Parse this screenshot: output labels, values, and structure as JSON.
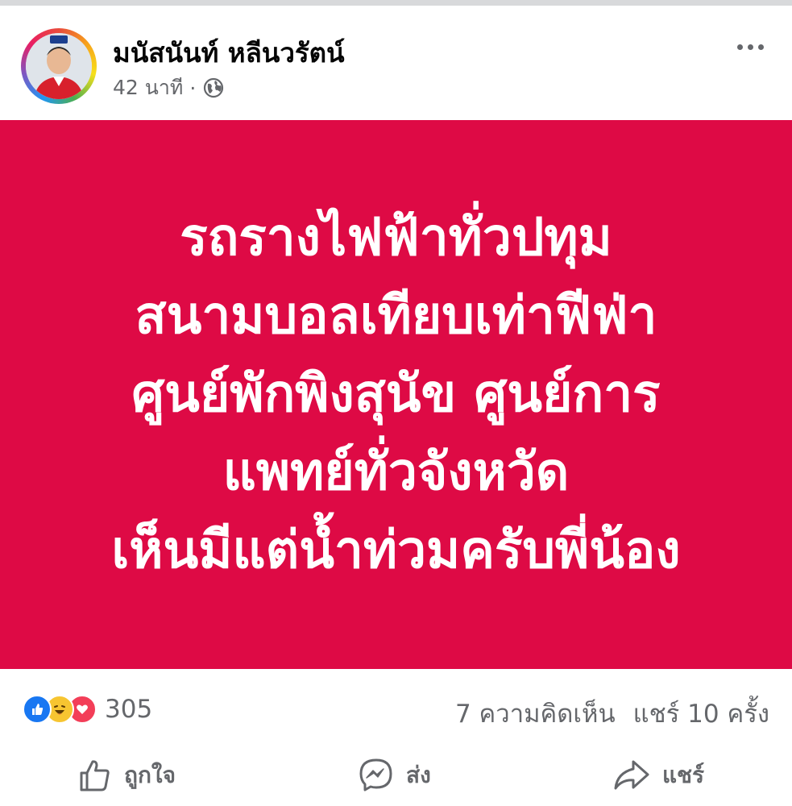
{
  "post": {
    "author": "มนัสนันท์ หลีนวรัตน์",
    "time": "42 นาที",
    "separator": "·",
    "privacy_icon": "globe-icon",
    "banner": {
      "background": "#de0a45",
      "lines": [
        "รถรางไฟฟ้าทั่วปทุม",
        "สนามบอลเทียบเท่าฟีฟ่า",
        "ศูนย์พักพิงสุนัข ศูนย์การ",
        "แพทย์ทั่วจังหวัด",
        "เห็นมีแต่น้ำท่วมครับพี่น้อง"
      ]
    }
  },
  "stats": {
    "reaction_icons": [
      "like-icon",
      "haha-icon",
      "love-icon"
    ],
    "reaction_count": "305",
    "comments": "7 ความคิดเห็น",
    "shares": "แชร์ 10 ครั้ง"
  },
  "actions": {
    "like": "ถูกใจ",
    "send": "ส่ง",
    "share": "แชร์"
  },
  "colors": {
    "banner": "#de0a45",
    "like_blue": "#1877f2",
    "love_red": "#f33e58",
    "haha_yellow": "#f7c531",
    "meta_gray": "#65676b"
  }
}
